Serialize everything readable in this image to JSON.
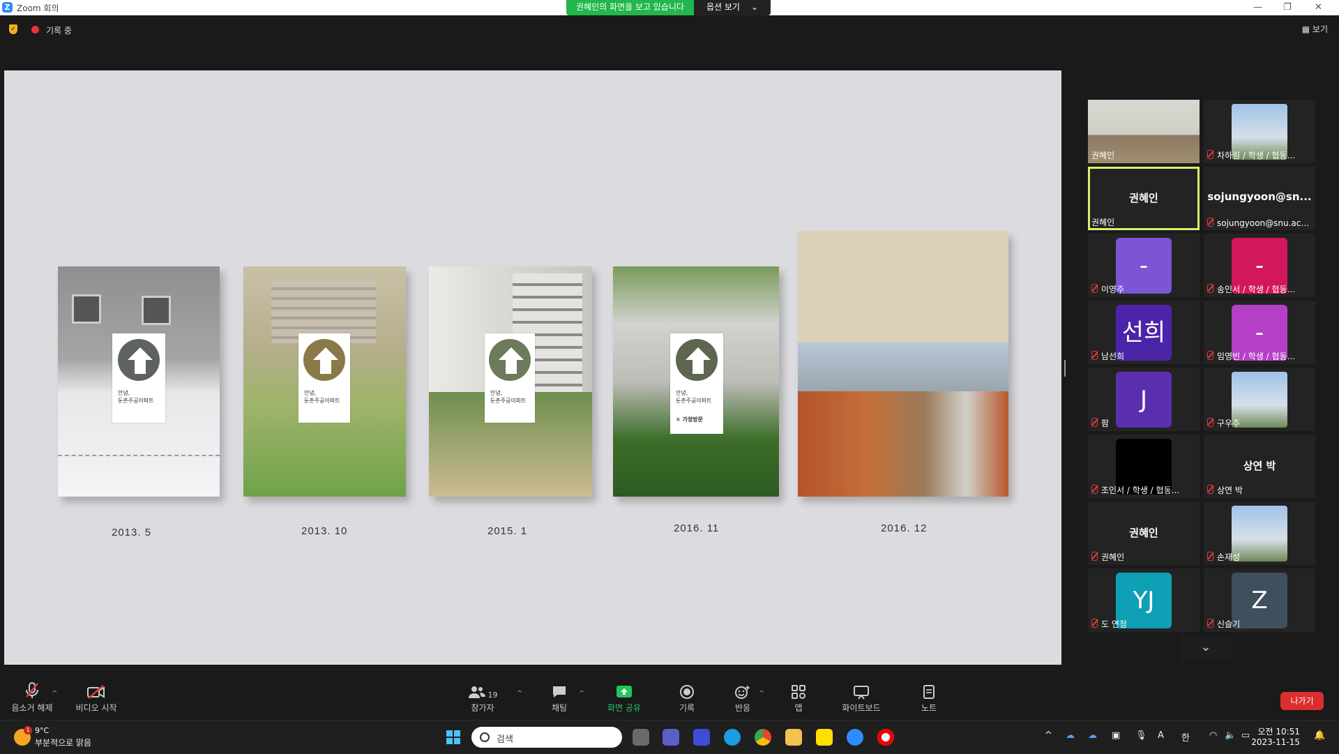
{
  "window": {
    "title": "Zoom 회의",
    "share_banner": "권혜인의 화면을 보고 있습니다",
    "options_label": "옵션 보기",
    "recording_label": "기록 중",
    "view_label": "보기"
  },
  "slide": {
    "years": [
      "2013. 5",
      "2013. 10",
      "2015. 1",
      "2016. 11",
      "2016. 12"
    ],
    "book_title": "안녕,\n둔촌주공아파트",
    "book4_extra": "가정방문"
  },
  "gallery": {
    "tiles": [
      {
        "name": "권혜인",
        "kind": "video",
        "muted": false
      },
      {
        "name": "차하림 / 학생 / 협동...",
        "kind": "image",
        "muted": true
      },
      {
        "name": "권혜인",
        "kind": "text",
        "center": "권혜인",
        "muted": false,
        "active": true
      },
      {
        "name": "sojungyoon@snu.ac.kr",
        "kind": "text",
        "center": "sojungyoon@sn...",
        "muted": true
      },
      {
        "name": "이영주",
        "kind": "avatar",
        "avatar": "-",
        "color": "#7b55d4",
        "muted": true
      },
      {
        "name": "송인서 / 학생 / 협동...",
        "kind": "avatar",
        "avatar": "-",
        "color": "#d3175c",
        "muted": true
      },
      {
        "name": "남선희",
        "kind": "avatar",
        "avatar": "선희",
        "color": "#4b24a8",
        "muted": true
      },
      {
        "name": "임영빈 / 학생 / 협동...",
        "kind": "avatar",
        "avatar": "-",
        "color": "#b63fc7",
        "muted": true
      },
      {
        "name": "팜",
        "kind": "avatar",
        "avatar": "J",
        "color": "#5a2fae",
        "muted": true
      },
      {
        "name": "구우주",
        "kind": "image",
        "muted": true
      },
      {
        "name": "조인서 / 학생 / 협동...",
        "kind": "avatar",
        "avatar": "",
        "color": "#000000",
        "muted": true
      },
      {
        "name": "상연 박",
        "kind": "text",
        "center": "상연 박",
        "muted": true
      },
      {
        "name": "권혜인",
        "kind": "text",
        "center": "권혜인",
        "muted": true
      },
      {
        "name": "손재성",
        "kind": "image",
        "muted": true
      },
      {
        "name": "도 연정",
        "kind": "avatar",
        "avatar": "YJ",
        "color": "#10a0b5",
        "muted": true
      },
      {
        "name": "신슬기",
        "kind": "avatar",
        "avatar": "Z",
        "color": "#3f4f5c",
        "muted": true
      }
    ]
  },
  "toolbar": {
    "unmute": "음소거 해제",
    "start_video": "비디오 시작",
    "participants": "참가자",
    "participants_count": "19",
    "chat": "채팅",
    "share": "화면 공유",
    "record": "기록",
    "reactions": "반응",
    "apps": "앱",
    "whiteboard": "화이트보드",
    "notes": "노트",
    "leave": "나가기"
  },
  "taskbar": {
    "weather_temp": "9°C",
    "weather_desc": "부분적으로 맑음",
    "weather_badge": "1",
    "search_placeholder": "검색",
    "clock_time": "오전 10:51",
    "clock_date": "2023-11-15",
    "ime_a": "A",
    "ime_lang": "한"
  }
}
